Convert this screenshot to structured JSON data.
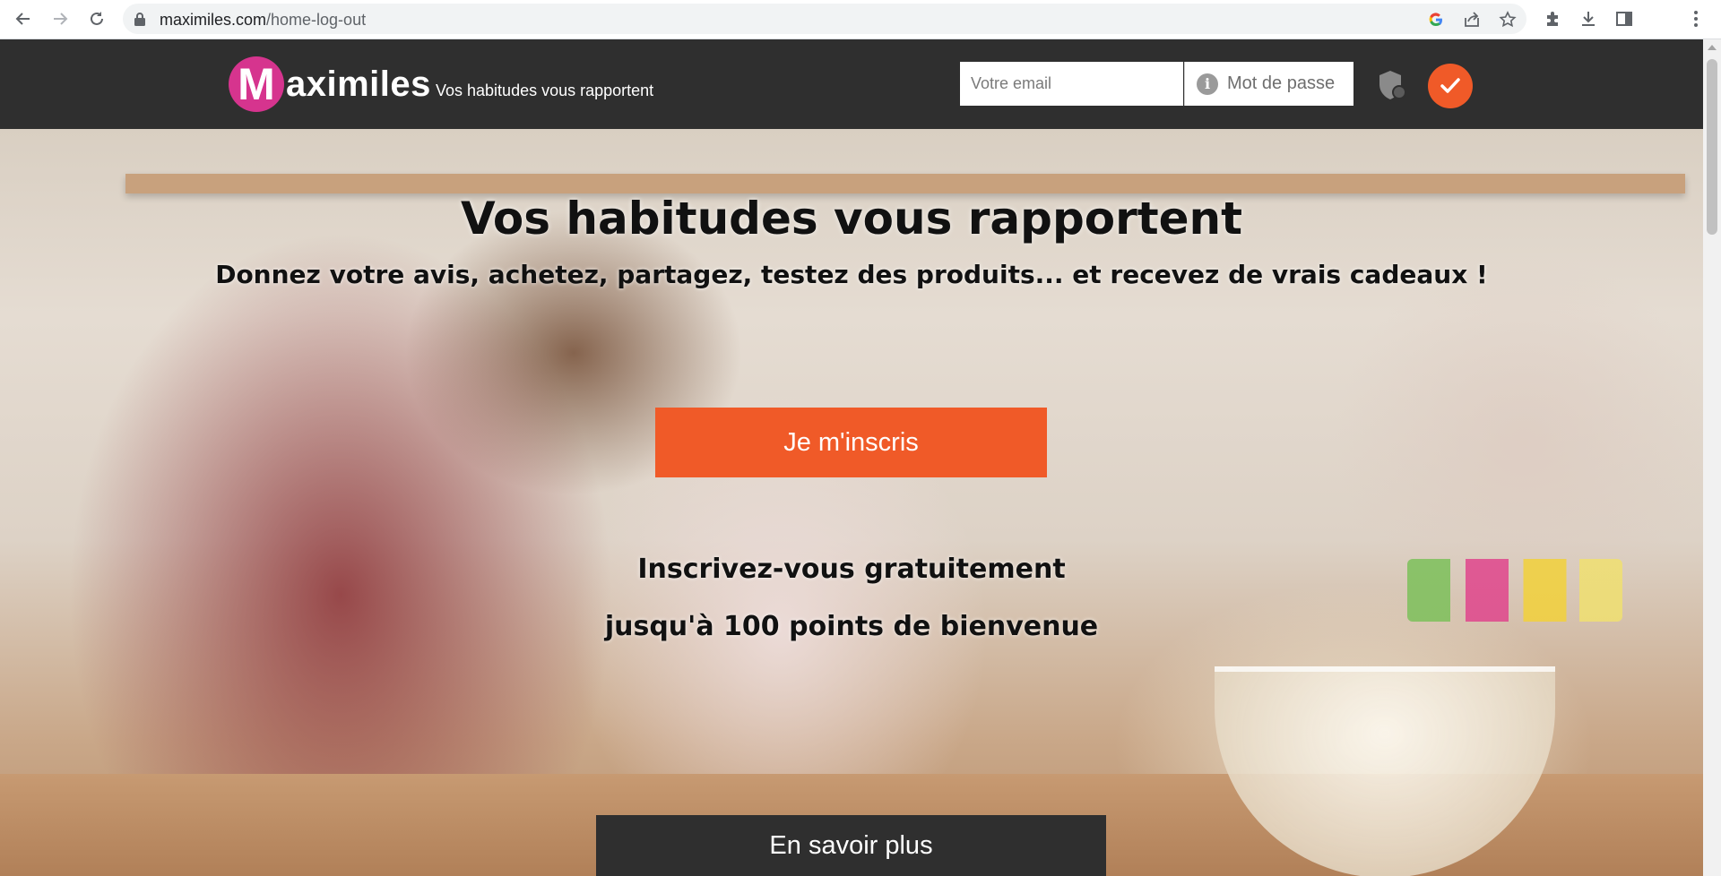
{
  "browser": {
    "url_domain": "maximiles.com",
    "url_path": "/home-log-out"
  },
  "header": {
    "logo_letter": "M",
    "logo_text": "aximiles",
    "tagline": "Vos habitudes vous rapportent",
    "email_placeholder": "Votre email",
    "password_placeholder": "Mot de passe",
    "info_glyph": "i"
  },
  "hero": {
    "title": "Vos habitudes vous rapportent",
    "subtitle": "Donnez votre avis, achetez, partagez, testez des produits... et recevez de vrais cadeaux !",
    "signup_label": "Je m'inscris",
    "free_text": "Inscrivez-vous gratuitement",
    "points_text": "jusqu'à 100 points de bienvenue",
    "more_label": "En savoir plus"
  },
  "colors": {
    "header_bg": "#2f2f2f",
    "accent": "#f05a28",
    "logo_pink": "#d6348e"
  },
  "icons": [
    "back-icon",
    "forward-icon",
    "reload-icon",
    "lock-icon",
    "google-icon",
    "share-icon",
    "star-icon",
    "extensions-icon",
    "download-icon",
    "sidepanel-icon",
    "menu-icon",
    "info-icon",
    "shield-icon",
    "check-icon"
  ]
}
